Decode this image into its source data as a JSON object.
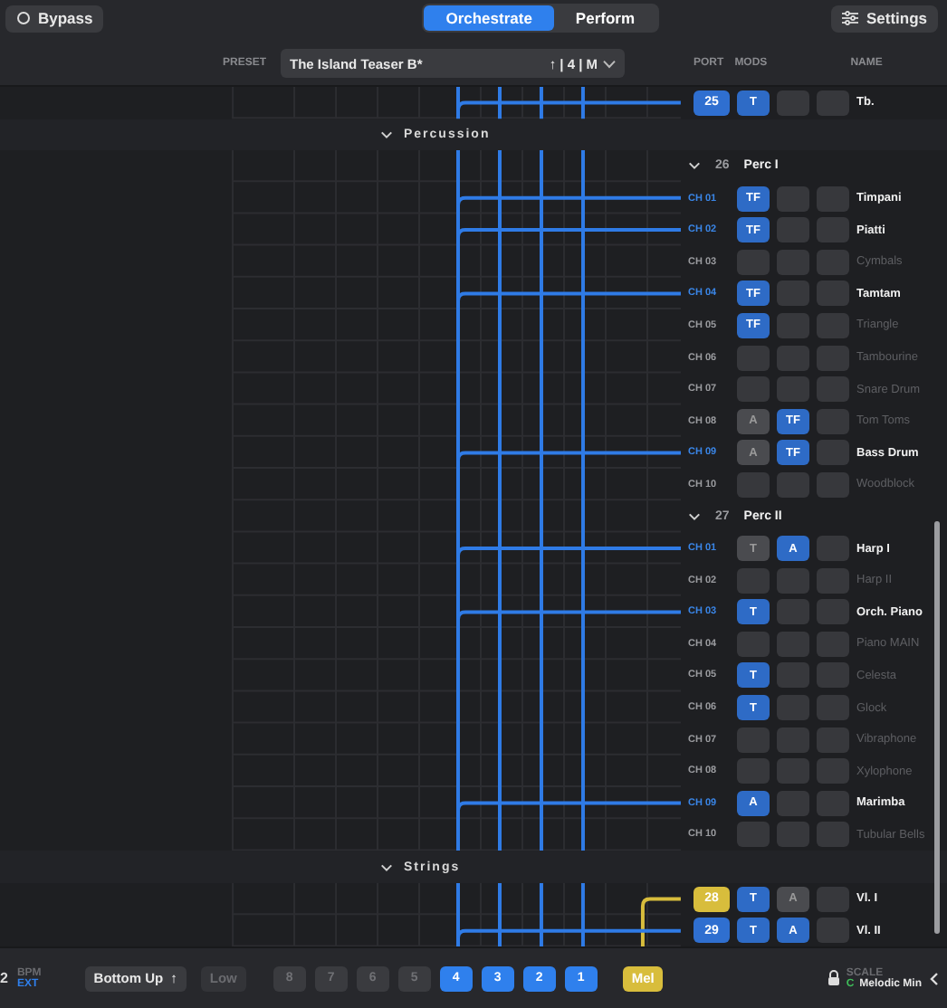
{
  "top_bar": {
    "bypass": {
      "label": "Bypass",
      "on": false
    },
    "modes": [
      {
        "label": "Orchestrate",
        "selected": true
      },
      {
        "label": "Perform",
        "selected": false
      }
    ],
    "settings": {
      "label": "Settings"
    }
  },
  "preset": {
    "label": "PRESET",
    "value": "The Island Teaser B*",
    "suffix": "↑ | 4 | M"
  },
  "columns": [
    "PORT",
    "MODS",
    "NAME"
  ],
  "rows": [
    {
      "kind": "port",
      "port": "25",
      "color": "#2f6fd0",
      "mods": [
        {
          "label": "T",
          "active": true
        },
        {
          "active": false
        },
        {
          "active": false
        }
      ],
      "name": "Tb."
    },
    {
      "kind": "section",
      "label": "Percussion",
      "expanded": true
    },
    {
      "kind": "group",
      "number": "26",
      "name": "Perc I",
      "expanded": true
    },
    {
      "kind": "channel",
      "channel": "CH 01",
      "connected": true,
      "mods": [
        {
          "label": "TF",
          "active": true
        },
        {
          "active": false
        },
        {
          "active": false
        }
      ],
      "name": "Timpani"
    },
    {
      "kind": "channel",
      "channel": "CH 02",
      "connected": true,
      "mods": [
        {
          "label": "TF",
          "active": true
        },
        {
          "active": false
        },
        {
          "active": false
        }
      ],
      "name": "Piatti"
    },
    {
      "kind": "channel",
      "channel": "CH 03",
      "connected": false,
      "mods": [
        {
          "active": false
        },
        {
          "active": false
        },
        {
          "active": false
        }
      ],
      "name": "Cymbals"
    },
    {
      "kind": "channel",
      "channel": "CH 04",
      "connected": true,
      "mods": [
        {
          "label": "TF",
          "active": true
        },
        {
          "active": false
        },
        {
          "active": false
        }
      ],
      "name": "Tamtam"
    },
    {
      "kind": "channel",
      "channel": "CH 05",
      "connected": false,
      "mods": [
        {
          "label": "TF",
          "active": true
        },
        {
          "active": false
        },
        {
          "active": false
        }
      ],
      "name": "Triangle"
    },
    {
      "kind": "channel",
      "channel": "CH 06",
      "connected": false,
      "mods": [
        {
          "active": false
        },
        {
          "active": false
        },
        {
          "active": false
        }
      ],
      "name": "Tambourine"
    },
    {
      "kind": "channel",
      "channel": "CH 07",
      "connected": false,
      "mods": [
        {
          "active": false
        },
        {
          "active": false
        },
        {
          "active": false
        }
      ],
      "name": "Snare Drum"
    },
    {
      "kind": "channel",
      "channel": "CH 08",
      "connected": false,
      "mods": [
        {
          "label": "A",
          "active": false
        },
        {
          "label": "TF",
          "active": true
        },
        {
          "active": false
        }
      ],
      "name": "Tom Toms"
    },
    {
      "kind": "channel",
      "channel": "CH 09",
      "connected": true,
      "mods": [
        {
          "label": "A",
          "active": false
        },
        {
          "label": "TF",
          "active": true
        },
        {
          "active": false
        }
      ],
      "name": "Bass Drum"
    },
    {
      "kind": "channel",
      "channel": "CH 10",
      "connected": false,
      "mods": [
        {
          "active": false
        },
        {
          "active": false
        },
        {
          "active": false
        }
      ],
      "name": "Woodblock"
    },
    {
      "kind": "group",
      "number": "27",
      "name": "Perc II",
      "expanded": true
    },
    {
      "kind": "channel",
      "channel": "CH 01",
      "connected": true,
      "mods": [
        {
          "label": "T",
          "active": false
        },
        {
          "label": "A",
          "active": true
        },
        {
          "active": false
        }
      ],
      "name": "Harp I"
    },
    {
      "kind": "channel",
      "channel": "CH 02",
      "connected": false,
      "mods": [
        {
          "active": false
        },
        {
          "active": false
        },
        {
          "active": false
        }
      ],
      "name": "Harp II"
    },
    {
      "kind": "channel",
      "channel": "CH 03",
      "connected": true,
      "mods": [
        {
          "label": "T",
          "active": true
        },
        {
          "active": false
        },
        {
          "active": false
        }
      ],
      "name": "Orch. Piano"
    },
    {
      "kind": "channel",
      "channel": "CH 04",
      "connected": false,
      "mods": [
        {
          "active": false
        },
        {
          "active": false
        },
        {
          "active": false
        }
      ],
      "name": "Piano MAIN"
    },
    {
      "kind": "channel",
      "channel": "CH 05",
      "connected": false,
      "mods": [
        {
          "label": "T",
          "active": true
        },
        {
          "active": false
        },
        {
          "active": false
        }
      ],
      "name": "Celesta"
    },
    {
      "kind": "channel",
      "channel": "CH 06",
      "connected": false,
      "mods": [
        {
          "label": "T",
          "active": true
        },
        {
          "active": false
        },
        {
          "active": false
        }
      ],
      "name": "Glock"
    },
    {
      "kind": "channel",
      "channel": "CH 07",
      "connected": false,
      "mods": [
        {
          "active": false
        },
        {
          "active": false
        },
        {
          "active": false
        }
      ],
      "name": "Vibraphone"
    },
    {
      "kind": "channel",
      "channel": "CH 08",
      "connected": false,
      "mods": [
        {
          "active": false
        },
        {
          "active": false
        },
        {
          "active": false
        }
      ],
      "name": "Xylophone"
    },
    {
      "kind": "channel",
      "channel": "CH 09",
      "connected": true,
      "mods": [
        {
          "label": "A",
          "active": true
        },
        {
          "active": false
        },
        {
          "active": false
        }
      ],
      "name": "Marimba"
    },
    {
      "kind": "channel",
      "channel": "CH 10",
      "connected": false,
      "mods": [
        {
          "active": false
        },
        {
          "active": false
        },
        {
          "active": false
        }
      ],
      "name": "Tubular Bells"
    },
    {
      "kind": "section",
      "label": "Strings",
      "expanded": true
    },
    {
      "kind": "port",
      "port": "28",
      "color": "#d8bd3c",
      "mods": [
        {
          "label": "T",
          "active": true
        },
        {
          "label": "A",
          "active": false
        },
        {
          "active": false
        }
      ],
      "name": "Vl. I"
    },
    {
      "kind": "port",
      "port": "29",
      "color": "#2f6fd0",
      "mods": [
        {
          "label": "T",
          "active": true
        },
        {
          "label": "A",
          "active": true
        },
        {
          "active": false
        }
      ],
      "name": "Vl. II"
    }
  ],
  "bottom_bar": {
    "tempo": "2",
    "bpm_label": "BPM",
    "clock": "EXT",
    "order": {
      "label": "Bottom Up",
      "arrow": "↑"
    },
    "range": {
      "label": "Low",
      "disabled": true
    },
    "voices": [
      {
        "label": "8",
        "selected": false
      },
      {
        "label": "7",
        "selected": false
      },
      {
        "label": "6",
        "selected": false
      },
      {
        "label": "5",
        "selected": false
      },
      {
        "label": "4",
        "selected": true
      },
      {
        "label": "3",
        "selected": true
      },
      {
        "label": "2",
        "selected": true
      },
      {
        "label": "1",
        "selected": true
      }
    ],
    "mel": {
      "label": "Mel",
      "on": true
    },
    "scale": {
      "label": "SCALE",
      "root": "C",
      "name": "Melodic Min",
      "locked": true
    }
  }
}
